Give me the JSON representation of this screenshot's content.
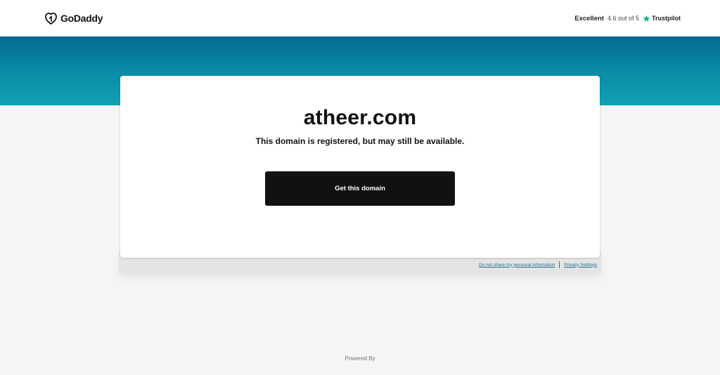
{
  "header": {
    "brand": "GoDaddy",
    "trustpilot": {
      "rating_word": "Excellent",
      "score_text": "4.6 out of 5",
      "provider": "Trustpilot"
    }
  },
  "card": {
    "domain_name": "atheer.com",
    "status_text": "This domain is registered, but may still be available.",
    "cta_label": "Get this domain"
  },
  "footer_links": {
    "do_not_share": "Do not share my personal information",
    "privacy_settings": "Privacy Settings"
  },
  "powered_by": "Powered By",
  "colors": {
    "band_top": "#046a93",
    "band_bottom": "#13a0b3",
    "cta_bg": "#111111",
    "trustpilot_star": "#00b67a",
    "link": "#1f6f8b"
  },
  "icons": {
    "logo": "godaddy-logo-icon",
    "trustpilot": "trustpilot-star-icon"
  }
}
